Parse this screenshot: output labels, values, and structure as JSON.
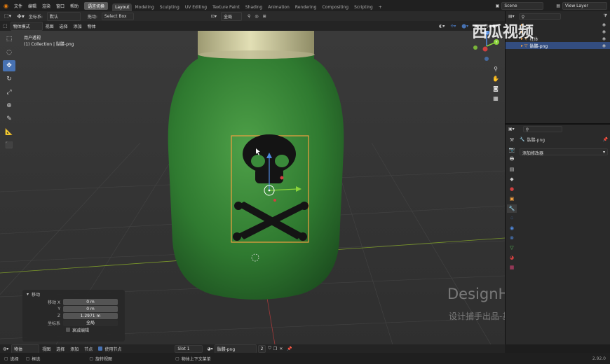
{
  "top_menu": {
    "items": [
      "文件",
      "编辑",
      "渲染",
      "窗口",
      "帮助"
    ],
    "lang_button": "语言切换",
    "workspaces": [
      "Layout",
      "Modeling",
      "Sculpting",
      "UV Editing",
      "Texture Paint",
      "Shading",
      "Animation",
      "Rendering",
      "Compositing",
      "Scripting"
    ],
    "add_workspace": "+",
    "scene": "Scene",
    "view_layer": "View Layer"
  },
  "tool_header": {
    "coord_label": "坐标系:",
    "coord_value": "默认",
    "drag_label": "拖动:",
    "drag_value": "Select Box",
    "global": "全局"
  },
  "view_header": {
    "mode": "物体模式",
    "menus": [
      "视图",
      "选择",
      "添加",
      "物体"
    ]
  },
  "viewport": {
    "title": "用户透视",
    "subtitle": "(1) Collection | 骷髅-png",
    "axis_z": "Z",
    "axis_y": "Y"
  },
  "redo_panel": {
    "title": "移动",
    "move_x_label": "移动 X",
    "move_x": "0 m",
    "y_label": "Y",
    "y": "0 m",
    "z_label": "Z",
    "z": "1.2971 m",
    "orient_label": "坐标系",
    "orient": "全局",
    "proportional": "衰减编辑"
  },
  "outliner": {
    "rows": [
      {
        "name": "",
        "selected": false
      },
      {
        "name": "",
        "selected": false
      },
      {
        "name": "柱体",
        "selected": false
      },
      {
        "name": "骷髅-png",
        "selected": true
      }
    ]
  },
  "properties": {
    "search_placeholder": "",
    "object_name": "骷髅-png",
    "add_modifier": "添加修改器"
  },
  "timeline_header": {
    "mode": "物体",
    "menus": [
      "视图",
      "选择",
      "添加",
      "节点"
    ],
    "use_nodes": "使用节点",
    "slot": "Slot 1",
    "material": "骷髅-png",
    "users": "2"
  },
  "status_bar": {
    "items": [
      "选择",
      "框选",
      "旋转视图",
      "物体上下文菜单"
    ],
    "version": "2.92.0"
  },
  "watermark": {
    "logo": "西瓜视频",
    "brand": "DesignHunting",
    "caption": "设计捕手出品-基础部分"
  },
  "colors": {
    "accent": "#4772b3",
    "bottle": "#3a8a3a",
    "selection": "#f2a040",
    "bg": "#3a3a3a"
  }
}
